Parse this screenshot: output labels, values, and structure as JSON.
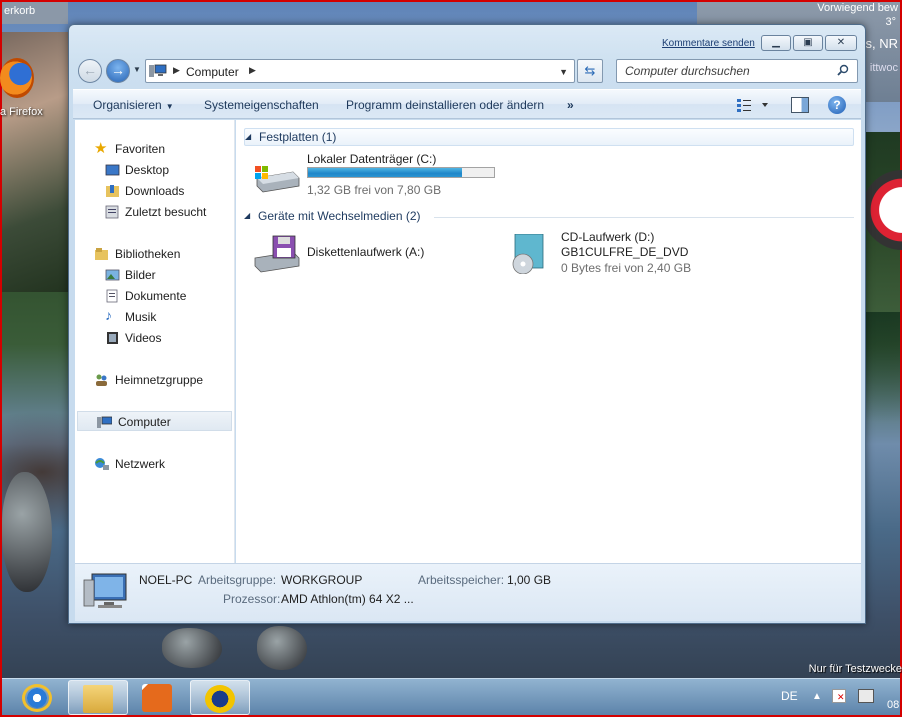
{
  "desktop": {
    "topbar_label": "erkorb",
    "firefox_label": "a Firefox",
    "weather": {
      "line1": "Vorwiegend bew",
      "line2": "3°",
      "line3": "s, NR",
      "line4": "ittwoc"
    },
    "watermark": "Nur für Testzwecke"
  },
  "window": {
    "feedback_link": "Kommentare senden",
    "address": {
      "crumb": "Computer"
    },
    "search": {
      "placeholder": "Computer durchsuchen"
    },
    "toolbar": {
      "organize": "Organisieren",
      "system_props": "Systemeigenschaften",
      "uninstall": "Programm deinstallieren oder ändern",
      "more": "»"
    },
    "nav": {
      "favorites": "Favoriten",
      "desktop": "Desktop",
      "downloads": "Downloads",
      "recent": "Zuletzt besucht",
      "libraries": "Bibliotheken",
      "pictures": "Bilder",
      "documents": "Dokumente",
      "music": "Musik",
      "videos": "Videos",
      "homegroup": "Heimnetzgruppe",
      "computer": "Computer",
      "network": "Netzwerk"
    },
    "groups": {
      "harddisks": "Festplatten (1)",
      "removable": "Geräte mit Wechselmedien (2)"
    },
    "drives": {
      "c": {
        "name": "Lokaler Datenträger (C:)",
        "free_text": "1,32 GB frei von 7,80 GB",
        "used_fraction": 0.83
      },
      "a": {
        "name": "Diskettenlaufwerk (A:)"
      },
      "d": {
        "name": "CD-Laufwerk (D:)",
        "label": "GB1CULFRE_DE_DVD",
        "free_text": "0 Bytes frei von 2,40 GB"
      }
    },
    "details": {
      "pc_name": "NOEL-PC",
      "workgroup_key": "Arbeitsgruppe:",
      "workgroup_val": "WORKGROUP",
      "memory_key": "Arbeitsspeicher:",
      "memory_val": "1,00 GB",
      "cpu_key": "Prozessor:",
      "cpu_val": "AMD Athlon(tm) 64 X2 ..."
    }
  },
  "taskbar": {
    "language": "DE",
    "clock": "08"
  },
  "colors": {
    "accent": "#1f87c9",
    "link": "#1c3e73"
  }
}
